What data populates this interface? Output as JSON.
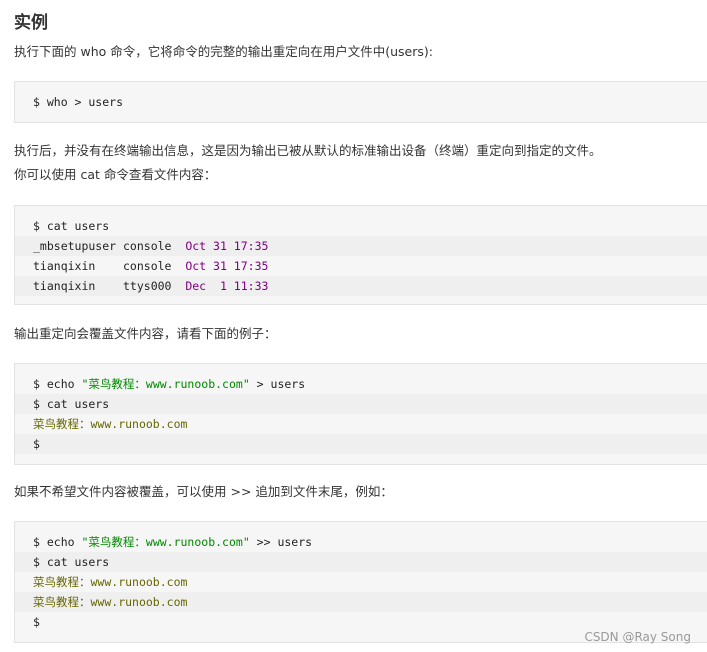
{
  "heading": "实例",
  "paragraphs": {
    "p1": "执行下面的 who 命令，它将命令的完整的输出重定向在用户文件中(users):",
    "p2": "执行后，并没有在终端输出信息，这是因为输出已被从默认的标准输出设备（终端）重定向到指定的文件。",
    "p3": "你可以使用 cat 命令查看文件内容：",
    "p4": "输出重定向会覆盖文件内容，请看下面的例子：",
    "p5": "如果不希望文件内容被覆盖，可以使用 >> 追加到文件末尾，例如："
  },
  "code1": {
    "line1": "$ who > users"
  },
  "code2": {
    "line1": "$ cat users",
    "rows": [
      {
        "prefix": "_mbsetupuser console  ",
        "date": "Oct 31 17:35"
      },
      {
        "prefix": "tianqixin    console  ",
        "date": "Oct 31 17:35"
      },
      {
        "prefix": "tianqixin    ttys000  ",
        "date": "Dec  1 11:33"
      }
    ]
  },
  "code3": {
    "l1_a": "$ echo ",
    "l1_str": "\"菜鸟教程：www.runoob.com\"",
    "l1_b": " > users",
    "l2": "$ cat users",
    "l3": "菜鸟教程：www.runoob.com",
    "l4": "$"
  },
  "code4": {
    "l1_a": "$ echo ",
    "l1_str": "\"菜鸟教程：www.runoob.com\"",
    "l1_b": " >> users",
    "l2": "$ cat users",
    "l3": "菜鸟教程：www.runoob.com",
    "l4": "菜鸟教程：www.runoob.com",
    "l5": "$"
  },
  "watermark": "CSDN @Ray Song"
}
